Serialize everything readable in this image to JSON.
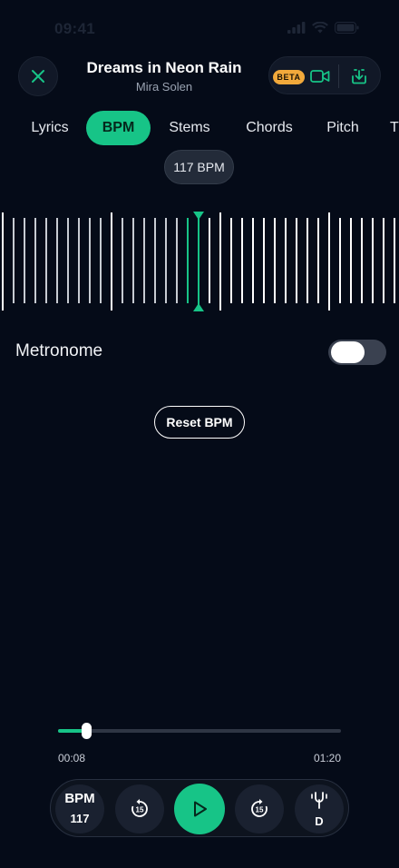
{
  "status_bar": {
    "time": "09:41"
  },
  "header": {
    "title": "Dreams in Neon Rain",
    "artist": "Mira Solen",
    "beta_label": "BETA"
  },
  "tabs": [
    {
      "label": "Lyrics",
      "active": false
    },
    {
      "label": "BPM",
      "active": true
    },
    {
      "label": "Stems",
      "active": false
    },
    {
      "label": "Chords",
      "active": false
    },
    {
      "label": "Pitch",
      "active": false
    },
    {
      "label": "T",
      "active": false
    }
  ],
  "bpm_selector": {
    "current_label": "117 BPM",
    "value": 117
  },
  "metronome": {
    "label": "Metronome",
    "enabled": false
  },
  "reset_button": {
    "label": "Reset BPM"
  },
  "playback": {
    "elapsed": "00:08",
    "total": "01:20",
    "progress": 0.1
  },
  "player_bar": {
    "bpm_label": "BPM",
    "bpm_value": "117",
    "rewind_label": "15",
    "forward_label": "15",
    "key_label": "D"
  },
  "colors": {
    "accent": "#17c487",
    "background": "#050b18",
    "beta": "#f2a93b"
  },
  "icons": {
    "close": "close-icon",
    "video": "video-camera-icon",
    "download": "download-icon",
    "rewind": "rewind-15-icon",
    "play": "play-icon",
    "forward": "forward-15-icon",
    "tuner": "tuning-fork-icon"
  }
}
